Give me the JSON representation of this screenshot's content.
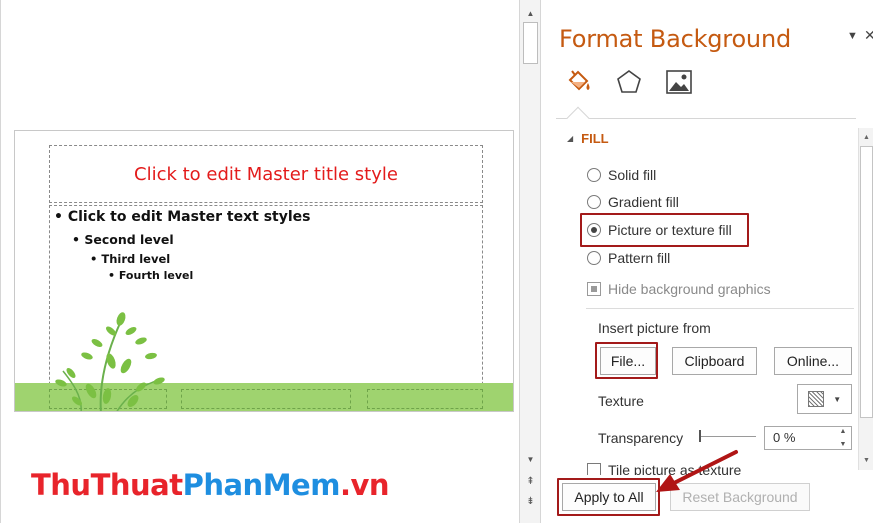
{
  "slide": {
    "title": "Click to edit Master title style",
    "levels": [
      "• Click to edit Master text styles",
      "• Second level",
      "• Third level",
      "• Fourth level"
    ]
  },
  "watermark": {
    "part1": "ThuThuat",
    "part2": "PhanMem",
    "part3": ".vn"
  },
  "pane": {
    "title": "Format Background",
    "dropdown_icon": "▼",
    "close_icon": "✕",
    "tabs": [
      "fill-tab",
      "effects-tab",
      "picture-tab"
    ],
    "section": "FILL",
    "fill_options": [
      {
        "label": "Solid fill",
        "selected": false
      },
      {
        "label": "Gradient fill",
        "selected": false
      },
      {
        "label": "Picture or texture fill",
        "selected": true
      },
      {
        "label": "Pattern fill",
        "selected": false
      }
    ],
    "hide_bg": "Hide background graphics",
    "insert_from": "Insert picture from",
    "file_btn": "File...",
    "clipboard_btn": "Clipboard",
    "online_btn": "Online...",
    "texture_label": "Texture",
    "transparency_label": "Transparency",
    "transparency_value": "0 %",
    "tile_label": "Tile picture as texture",
    "apply_all": "Apply to All",
    "reset": "Reset Background"
  },
  "colors": {
    "accent": "#c55a11",
    "highlight_box": "#a31a1a",
    "slide_band": "#9fd36f",
    "title_text": "#e31b1b"
  }
}
